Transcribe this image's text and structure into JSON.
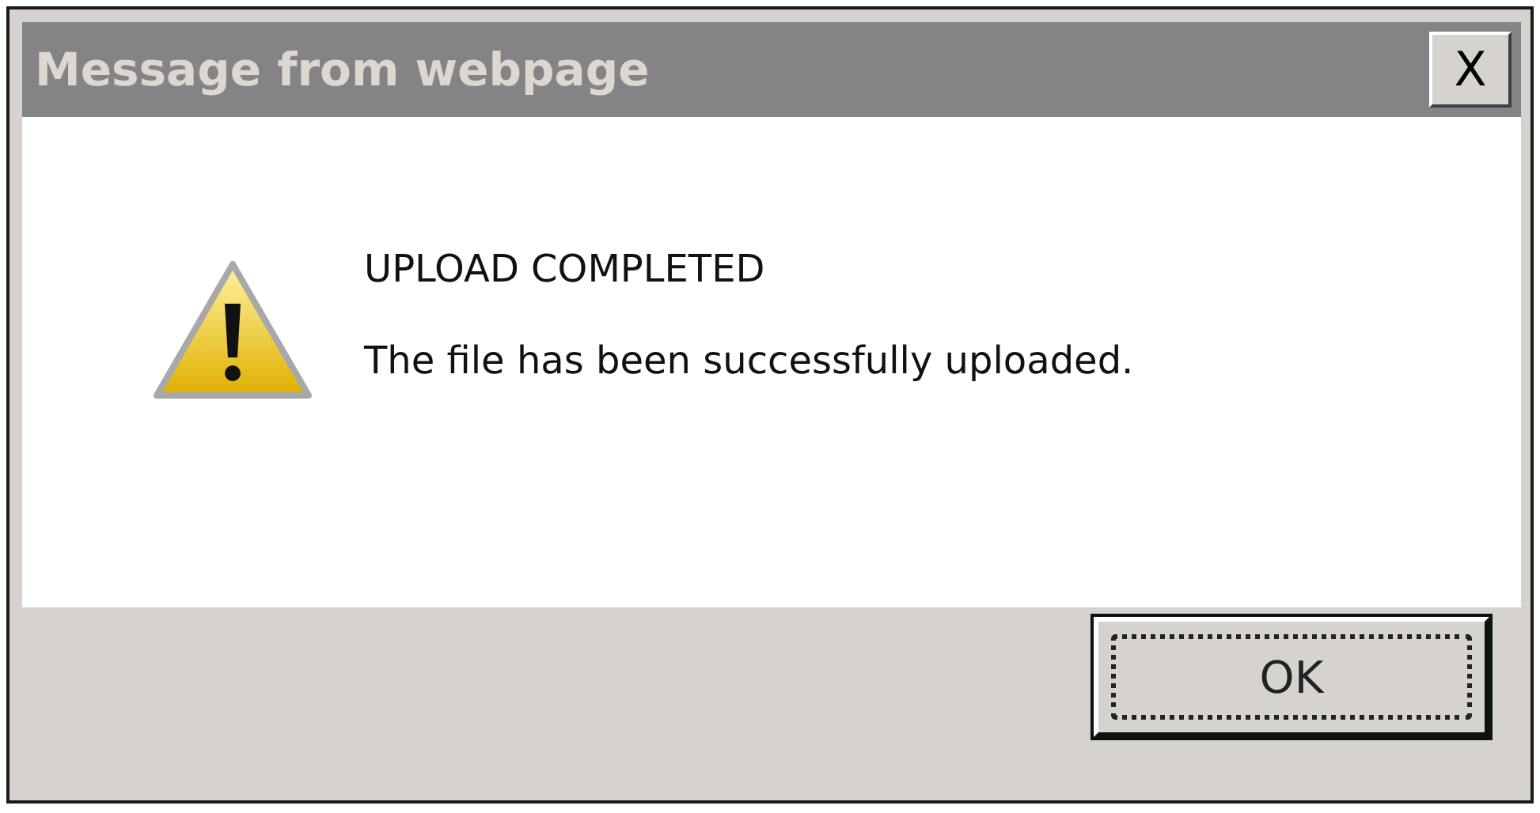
{
  "window": {
    "title": "Message from webpage",
    "close_label": "X"
  },
  "message": {
    "heading": "UPLOAD COMPLETED",
    "text": "The file has been successfully uploaded."
  },
  "buttons": [
    {
      "label": "OK",
      "focused": true
    }
  ]
}
